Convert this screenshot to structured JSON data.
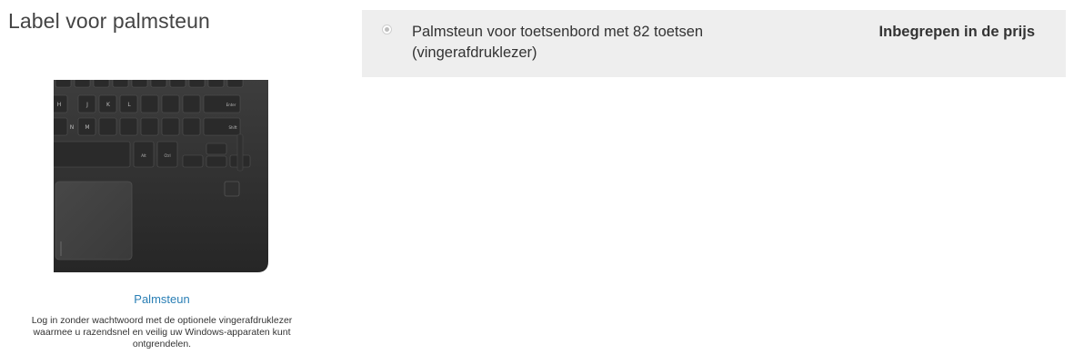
{
  "section": {
    "title": "Label voor palmsteun"
  },
  "figure": {
    "image_alt": "Palmsteun met vingerafdruklezer",
    "key_labels": [
      "H",
      "J",
      "K",
      "L",
      "N",
      "M",
      "Alt",
      "Ctrl",
      "Enter",
      "Shift"
    ],
    "caption_title": "Palmsteun",
    "caption_text": "Log in zonder wachtwoord met de optionele vingerafdruklezer waarmee u razendsnel en veilig uw Windows-apparaten kunt ontgrendelen."
  },
  "option": {
    "label": "Palmsteun voor toetsenbord met 82 toetsen (vingerafdruklezer)",
    "price": "Inbegrepen in de prijs",
    "selected": true
  },
  "colors": {
    "panel_bg": "#eeeeee",
    "caption_link": "#2a7fb5",
    "laptop": "#3a3a3a"
  }
}
